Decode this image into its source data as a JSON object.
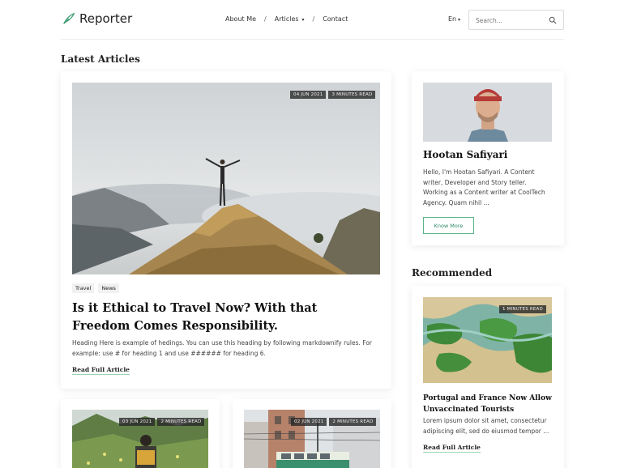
{
  "header": {
    "logo_text": "Reporter",
    "nav": [
      {
        "label": "About Me",
        "has_dropdown": false
      },
      {
        "label": "Articles",
        "has_dropdown": true
      },
      {
        "label": "Contact",
        "has_dropdown": false
      }
    ],
    "nav_separator": "/",
    "language": "En",
    "search_placeholder": "Search..."
  },
  "latest": {
    "section_title": "Latest Articles",
    "featured": {
      "date": "04 JUN 2021",
      "read_time": "3 MINUTES READ",
      "tags": [
        "Travel",
        "News"
      ],
      "title": "Is it Ethical to Travel Now? With that Freedom Comes Responsibility.",
      "excerpt": "Heading Here is example of hedings. You can use this heading by following markdownify rules. For example: use # for heading 1 and use ###### for heading 6.",
      "read_link": "Read Full Article"
    },
    "small_cards": [
      {
        "date": "03 JUN 2021",
        "read_time": "2 MINUTES READ"
      },
      {
        "date": "02 JUN 2021",
        "read_time": "2 MINUTES READ"
      }
    ]
  },
  "author": {
    "name": "Hootan Safiyari",
    "bio": "Hello, I'm Hootan Safiyari. A Content writer, Developer and Story teller. Working as a Content writer at CoolTech Agency. Quam nihil ...",
    "button": "Know More"
  },
  "recommended": {
    "section_title": "Recommended",
    "read_time": "1 MINUTES READ",
    "title": "Portugal and France Now Allow Unvaccinated Tourists",
    "excerpt": "Lorem ipsum dolor sit amet, consectetur adipiscing elit, sed do eiusmod tempor ...",
    "read_link": "Read Full Article"
  },
  "colors": {
    "accent": "#58b58c",
    "text": "#222222",
    "badge": "#333333"
  }
}
